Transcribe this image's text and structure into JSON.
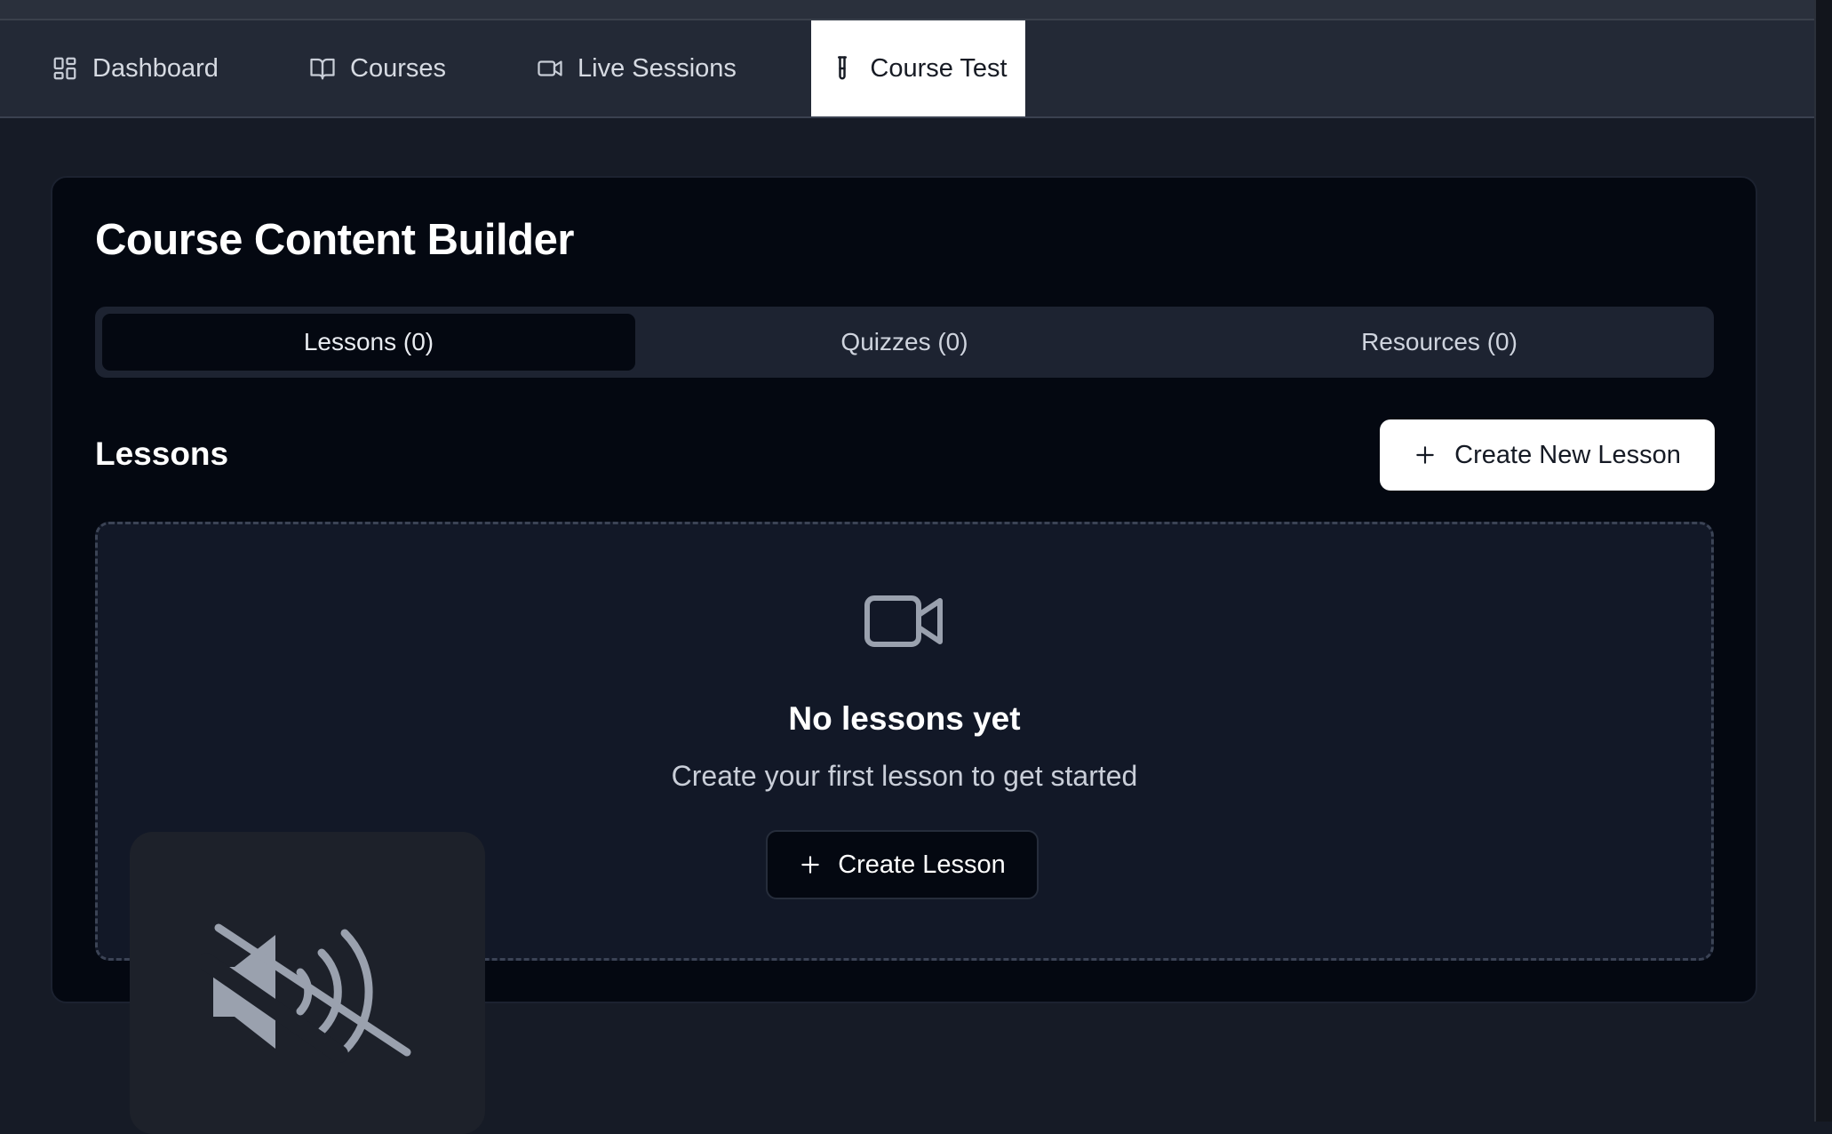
{
  "nav": {
    "items": [
      {
        "label": "Dashboard",
        "icon": "dashboard-icon"
      },
      {
        "label": "Courses",
        "icon": "book-icon"
      },
      {
        "label": "Live Sessions",
        "icon": "video-icon"
      },
      {
        "label": "Course Test",
        "icon": "test-tube-icon",
        "active": true
      }
    ]
  },
  "builder": {
    "title": "Course Content Builder",
    "tabs": [
      {
        "label": "Lessons (0)",
        "active": true
      },
      {
        "label": "Quizzes (0)"
      },
      {
        "label": "Resources (0)"
      }
    ],
    "section_heading": "Lessons",
    "create_new_label": "Create New Lesson",
    "empty_state": {
      "icon": "video-icon",
      "title": "No lessons yet",
      "subtitle": "Create your first lesson to get started",
      "button_label": "Create Lesson"
    }
  },
  "overlay": {
    "icon": "speaker-muted-icon"
  },
  "colors": {
    "background": "#161b26",
    "card": "#040811",
    "navbar": "#232936",
    "active_tab": "#ffffff",
    "empty_panel": "#121827",
    "icon_gray": "#9aa1ae"
  }
}
